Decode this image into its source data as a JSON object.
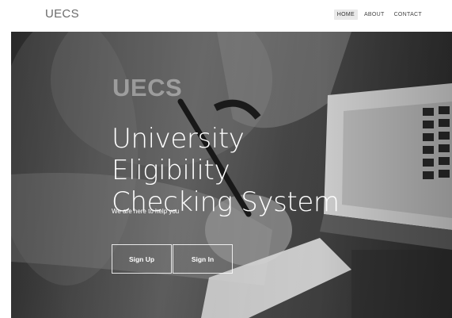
{
  "navbar": {
    "brand": "UECS",
    "links": [
      {
        "label": "HOME"
      },
      {
        "label": "ABOUT"
      },
      {
        "label": "CONTACT"
      }
    ]
  },
  "hero": {
    "logo": "UECS",
    "title_line1": "University Eligibility",
    "title_line2": "Checking System",
    "tagline": "We are here to help you",
    "buttons": {
      "signup": "Sign Up",
      "signin": "Sign In"
    }
  }
}
